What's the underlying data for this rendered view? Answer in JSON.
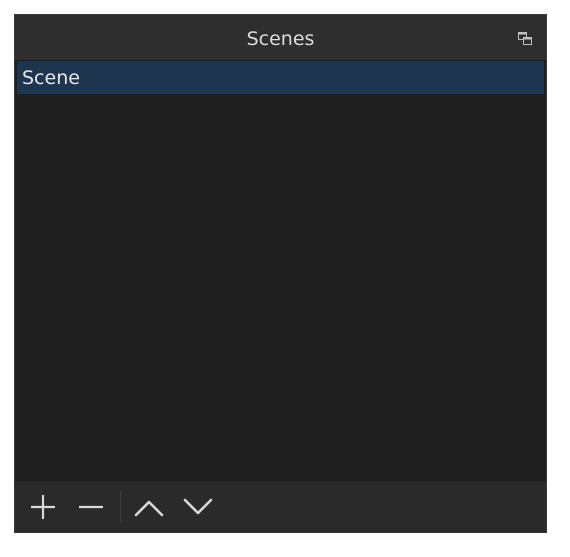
{
  "dock": {
    "title": "Scenes",
    "float_icon": "float-window-icon"
  },
  "scenes": {
    "items": [
      {
        "label": "Scene",
        "selected": true
      }
    ]
  },
  "toolbar": {
    "buttons": [
      {
        "icon": "plus-icon",
        "action": "add-scene"
      },
      {
        "icon": "minus-icon",
        "action": "remove-scene"
      },
      {
        "icon": "chevron-up-icon",
        "action": "move-scene-up"
      },
      {
        "icon": "chevron-down-icon",
        "action": "move-scene-down"
      }
    ]
  },
  "colors": {
    "panel_bg": "#1f1f1f",
    "titlebar_bg": "#2e2e2e",
    "selection_bg": "#1e3550",
    "toolbar_bg": "#2a2a2a",
    "text": "#dcdcdc"
  }
}
